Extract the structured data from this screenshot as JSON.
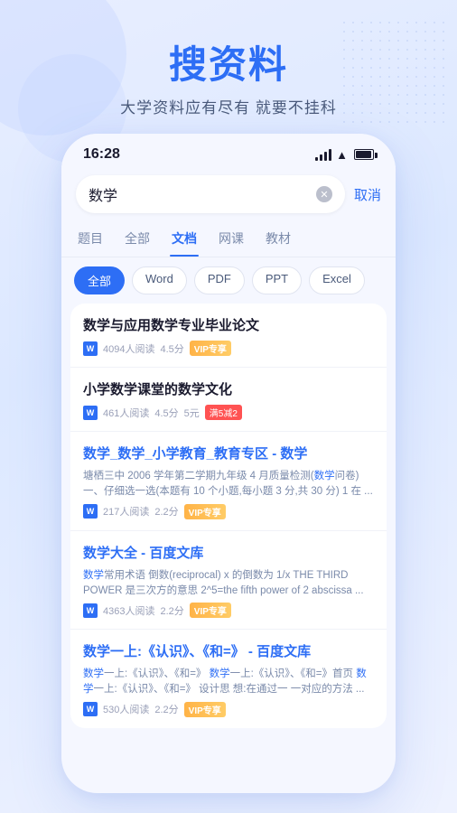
{
  "hero": {
    "title": "搜资料",
    "subtitle": "大学资料应有尽有 就要不挂科"
  },
  "status_bar": {
    "time": "16:28",
    "cancel_label": "取消"
  },
  "search": {
    "query": "数学",
    "placeholder": "数学"
  },
  "tabs": [
    {
      "label": "题目",
      "active": false
    },
    {
      "label": "全部",
      "active": false
    },
    {
      "label": "文档",
      "active": true
    },
    {
      "label": "网课",
      "active": false
    },
    {
      "label": "教材",
      "active": false
    }
  ],
  "filters": [
    {
      "label": "全部",
      "active": true
    },
    {
      "label": "Word",
      "active": false
    },
    {
      "label": "PDF",
      "active": false
    },
    {
      "label": "PPT",
      "active": false
    },
    {
      "label": "Excel",
      "active": false
    }
  ],
  "results": [
    {
      "title": "数学与应用数学专业毕业论文",
      "title_blue": false,
      "reads": "4094人阅读",
      "rating": "4.5分",
      "badge_type": "vip",
      "badge_label": "VIP专享",
      "snippet": "",
      "snippet_parts": []
    },
    {
      "title": "小学数学课堂的数学文化",
      "title_blue": false,
      "reads": "461人阅读",
      "rating": "4.5分",
      "price": "5元",
      "badge_type": "discount",
      "badge_label": "满5减2",
      "snippet": "",
      "snippet_parts": []
    },
    {
      "title": "数学_数学_小学教育_教育专区 - 数学",
      "title_blue": true,
      "reads": "217人阅读",
      "rating": "2.2分",
      "badge_type": "vip",
      "badge_label": "VIP专享",
      "snippet": "塘栖三中 2006 学年第二学期九年级 4 月质量检测(数学问卷) 一、仔细选一选(本题有 10 个小题,每小题 3 分,共 30 分) 1 在 ...",
      "snippet_keyword": "数学"
    },
    {
      "title": "数学大全 - 百度文库",
      "title_blue": true,
      "reads": "4363人阅读",
      "rating": "2.2分",
      "badge_type": "vip",
      "badge_label": "VIP专享",
      "snippet": "数学常用术语 倒数(reciprocal) x 的倒数为 1/x THE THIRD POWER 是三次方的意思 2^5=the fifth power of 2 abscissa ...",
      "snippet_keyword": "数学"
    },
    {
      "title": "数学一上:《认识》、《和=》 - 百度文库",
      "title_blue": true,
      "reads": "530人阅读",
      "rating": "2.2分",
      "badge_type": "vip",
      "badge_label": "VIP专享",
      "snippet": "数学一上:《认识》、《和=》 数学一上:《认识》、《和=》首页 数学一上:《认识》、《和=》 设计思 想:在通过一 一对应的方法 ...",
      "snippet_keyword": "数学"
    }
  ]
}
